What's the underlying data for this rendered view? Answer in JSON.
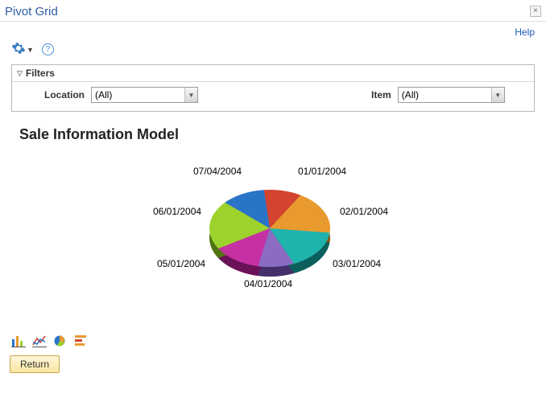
{
  "window": {
    "title": "Pivot Grid",
    "help_label": "Help"
  },
  "filters": {
    "header": "Filters",
    "location_label": "Location",
    "location_value": "(All)",
    "item_label": "Item",
    "item_value": "(All)"
  },
  "chart": {
    "title": "Sale Information Model"
  },
  "chart_data": {
    "type": "pie",
    "title": "Sale Information Model",
    "series": [
      {
        "name": "01/01/2004",
        "value": 14.3,
        "color": "#2a74c7"
      },
      {
        "name": "02/01/2004",
        "value": 14.3,
        "color": "#d4432f"
      },
      {
        "name": "03/01/2004",
        "value": 14.3,
        "color": "#e89a2e"
      },
      {
        "name": "04/01/2004",
        "value": 14.3,
        "color": "#1fb3ad"
      },
      {
        "name": "05/01/2004",
        "value": 14.3,
        "color": "#8a6cc2"
      },
      {
        "name": "06/01/2004",
        "value": 14.3,
        "color": "#c530a3"
      },
      {
        "name": "07/04/2004",
        "value": 14.3,
        "color": "#9dd12c"
      }
    ],
    "labels": [
      "01/01/2004",
      "02/01/2004",
      "03/01/2004",
      "04/01/2004",
      "05/01/2004",
      "06/01/2004",
      "07/04/2004"
    ]
  },
  "footer": {
    "return_label": "Return"
  }
}
